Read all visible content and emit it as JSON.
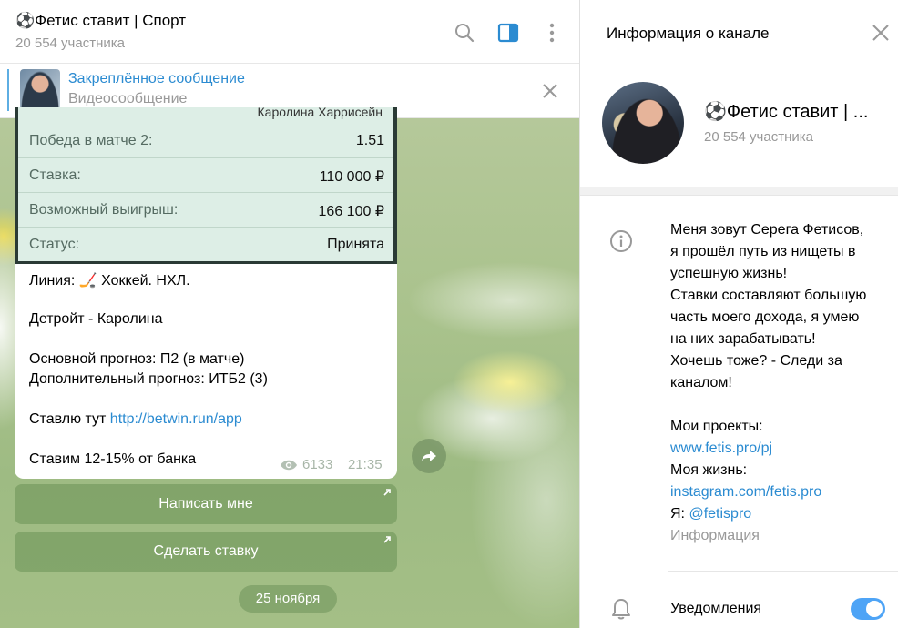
{
  "chat": {
    "title": "⚽Фетис ставит | Спорт",
    "subtitle": "20 554 участника",
    "pinned": {
      "title": "Закреплённое сообщение",
      "subtitle": "Видеосообщение"
    },
    "message": {
      "table_cut_text": "Каролина Харрисейн",
      "table": [
        {
          "label": "Победа в матче 2:",
          "value": "1.51"
        },
        {
          "label": "Ставка:",
          "value": "110 000 ₽"
        },
        {
          "label": "Возможный выигрыш:",
          "value": "166 100 ₽"
        },
        {
          "label": "Статус:",
          "value": "Принята"
        }
      ],
      "line": "Линия: 🏒 Хоккей. НХЛ.",
      "match": "Детройт - Каролина",
      "main_forecast": "Основной прогноз: П2 (в матче)",
      "extra_forecast": "Дополнительный прогноз: ИТБ2 (3)",
      "bet_here_prefix": "Ставлю тут ",
      "bet_here_link": "http://betwin.run/app",
      "bank": "Ставим 12-15% от банка",
      "views": "6133",
      "time": "21:35"
    },
    "buttons": {
      "write_me": "Написать мне",
      "make_bet": "Сделать ставку"
    },
    "date_pill": "25 ноября"
  },
  "info": {
    "title": "Информация о канале",
    "channel_name": "⚽Фетис ставит | ...",
    "members": "20 554 участника",
    "description": [
      "Меня зовут Серега Фетисов,",
      "я прошёл путь из нищеты в",
      "успешную жизнь!",
      "Ставки составляют большую",
      "часть моего дохода, я умею",
      "на них зарабатывать!",
      "Хочешь тоже? - Следи за",
      "каналом!",
      "",
      "Мои проекты:"
    ],
    "projects_link": "www.fetis.pro/pj",
    "life_label": "Моя жизнь:",
    "life_link": "instagram.com/fetis.pro",
    "me_prefix": "Я: ",
    "me_link": "@fetispro",
    "caption": "Информация",
    "notifications_label": "Уведомления",
    "notifications_on": true
  },
  "colors": {
    "accent": "#2b8bd1",
    "toggle": "#4ea4f6",
    "table_bg": "#ddeee6"
  },
  "icons": [
    "search-icon",
    "sidebar-toggle-icon",
    "more-vertical-icon",
    "close-icon",
    "eye-icon",
    "share-icon",
    "external-arrow-icon",
    "info-icon",
    "bell-icon"
  ]
}
